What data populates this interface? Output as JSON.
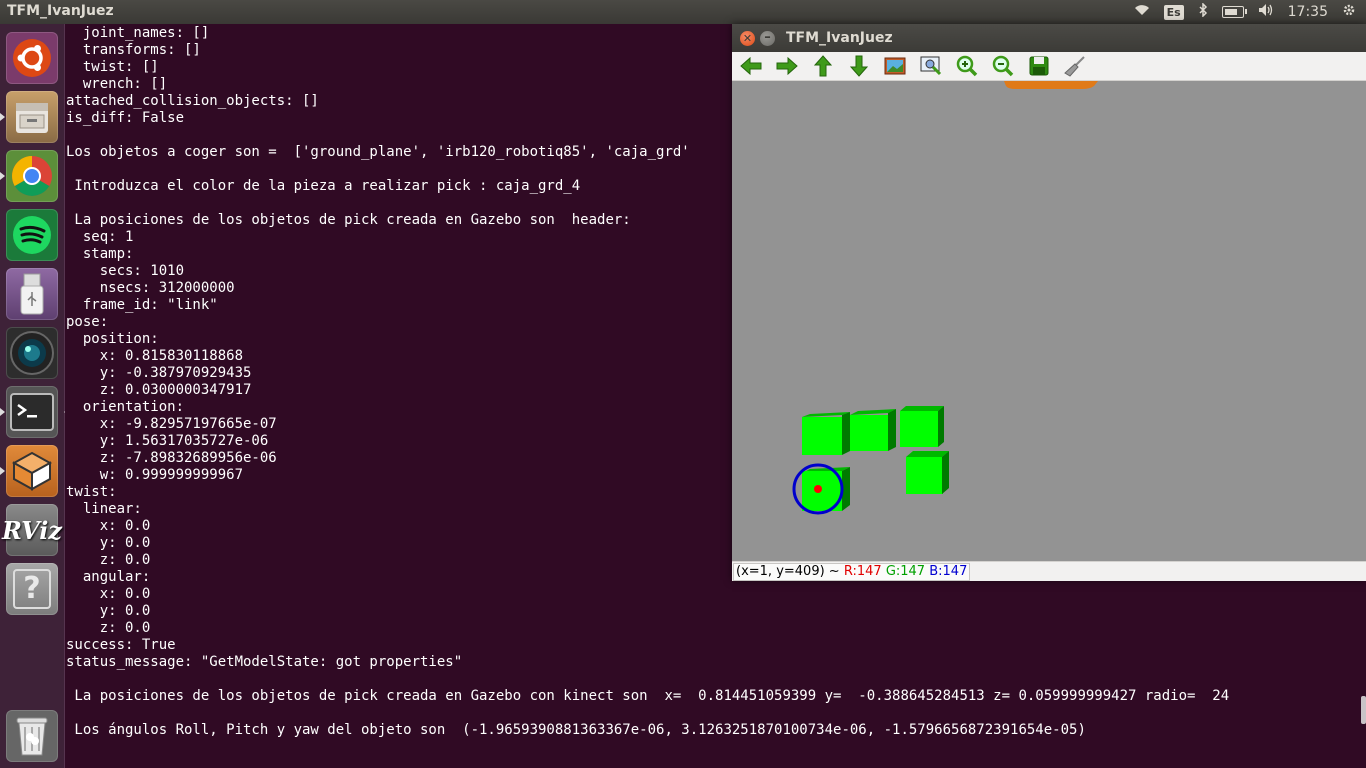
{
  "top_panel": {
    "window_title": "TFM_IvanJuez",
    "keyboard_layout": "Es",
    "clock": "17:35"
  },
  "launcher": {
    "items": [
      {
        "name": "Ubuntu Dash",
        "icon": "ubuntu-logo-icon"
      },
      {
        "name": "Files",
        "icon": "file-cabinet-icon"
      },
      {
        "name": "Google Chrome",
        "icon": "chrome-icon"
      },
      {
        "name": "Spotify",
        "icon": "spotify-icon"
      },
      {
        "name": "USB Drive",
        "icon": "usb-drive-icon"
      },
      {
        "name": "Webcam",
        "icon": "camera-lens-icon"
      },
      {
        "name": "Terminal",
        "icon": "terminal-icon"
      },
      {
        "name": "Sublime / Package",
        "icon": "box-icon"
      },
      {
        "name": "RViz",
        "icon": "rviz-icon",
        "label": "RViz"
      },
      {
        "name": "Unknown App",
        "icon": "question-mark-icon",
        "label": "?"
      },
      {
        "name": "Trash",
        "icon": "trash-icon"
      }
    ]
  },
  "terminal": {
    "lines": [
      "  joint_names: []",
      "  transforms: []",
      "  twist: []",
      "  wrench: []",
      "attached_collision_objects: []",
      "is_diff: False",
      "",
      "Los objetos a coger son =  ['ground_plane', 'irb120_robotiq85', 'caja_grd'",
      "",
      " Introduzca el color de la pieza a realizar pick : caja_grd_4",
      "",
      " La posiciones de los objetos de pick creada en Gazebo son  header:",
      "  seq: 1",
      "  stamp:",
      "    secs: 1010",
      "    nsecs: 312000000",
      "  frame_id: \"link\"",
      "pose:",
      "  position:",
      "    x: 0.815830118868",
      "    y: -0.387970929435",
      "    z: 0.0300000347917",
      "  orientation:",
      "    x: -9.82957197665e-07",
      "    y: 1.56317035727e-06",
      "    z: -7.89832689956e-06",
      "    w: 0.999999999967",
      "twist:",
      "  linear:",
      "    x: 0.0",
      "    y: 0.0",
      "    z: 0.0",
      "  angular:",
      "    x: 0.0",
      "    y: 0.0",
      "    z: 0.0",
      "success: True",
      "status_message: \"GetModelState: got properties\"",
      "",
      " La posiciones de los objetos de pick creada en Gazebo con kinect son  x=  0.814451059399 y=  -0.388645284513 z= 0.059999999427 radio=  24",
      "",
      " Los ángulos Roll, Pitch y yaw del objeto son  (-1.9659390881363367e-06, 3.1263251870100734e-06, -1.5796656872391654e-05)"
    ]
  },
  "image_window": {
    "title": "TFM_IvanJuez",
    "toolbar": [
      {
        "name": "back",
        "icon": "arrow-left-icon"
      },
      {
        "name": "forward",
        "icon": "arrow-right-icon"
      },
      {
        "name": "up",
        "icon": "arrow-up-icon"
      },
      {
        "name": "down",
        "icon": "arrow-down-icon"
      },
      {
        "name": "original-view",
        "icon": "image-icon"
      },
      {
        "name": "zoom-fit",
        "icon": "zoom-fit-icon"
      },
      {
        "name": "zoom-in",
        "icon": "zoom-in-icon"
      },
      {
        "name": "zoom-out",
        "icon": "zoom-out-icon"
      },
      {
        "name": "save",
        "icon": "floppy-disk-icon"
      },
      {
        "name": "clear",
        "icon": "broom-icon"
      }
    ],
    "status": {
      "coords": "(x=1, y=409) ~",
      "r": "R:147",
      "g": "G:147",
      "b": "B:147"
    },
    "colors": {
      "background": "#939393",
      "cube": "#00ff00",
      "detection_circle": "#0000cc",
      "center_dot": "#ff0000"
    }
  }
}
